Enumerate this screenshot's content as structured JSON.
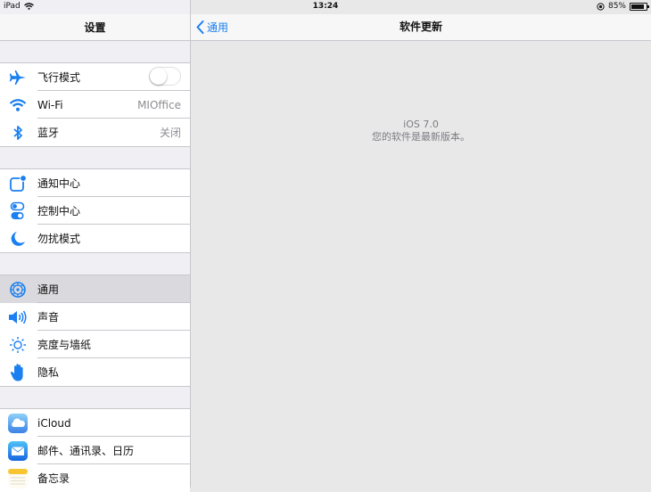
{
  "status": {
    "device": "iPad",
    "time": "13:24",
    "battery": "85%",
    "battery_level": 0.85
  },
  "master": {
    "title": "设置",
    "groups": [
      {
        "rows": [
          {
            "label": "飞行模式",
            "icon": "airplane-icon",
            "toggle": false
          },
          {
            "label": "Wi-Fi",
            "icon": "wifi-icon",
            "value": "MIOffice"
          },
          {
            "label": "蓝牙",
            "icon": "bluetooth-icon",
            "value": "关闭"
          }
        ]
      },
      {
        "rows": [
          {
            "label": "通知中心",
            "icon": "notification-center-icon"
          },
          {
            "label": "控制中心",
            "icon": "control-center-icon"
          },
          {
            "label": "勿扰模式",
            "icon": "moon-icon"
          }
        ]
      },
      {
        "rows": [
          {
            "label": "通用",
            "icon": "gear-icon",
            "selected": true
          },
          {
            "label": "声音",
            "icon": "speaker-icon"
          },
          {
            "label": "亮度与墙纸",
            "icon": "brightness-icon"
          },
          {
            "label": "隐私",
            "icon": "hand-icon"
          }
        ]
      },
      {
        "rows": [
          {
            "label": "iCloud",
            "icon": "icloud-icon"
          },
          {
            "label": "邮件、通讯录、日历",
            "icon": "mail-icon"
          },
          {
            "label": "备忘录",
            "icon": "notes-icon"
          }
        ]
      }
    ]
  },
  "detail": {
    "back_label": "通用",
    "title": "软件更新",
    "version": "iOS 7.0",
    "message": "您的软件是最新版本。"
  },
  "colors": {
    "accent": "#1a7ff0",
    "separator": "#c8c7cc",
    "background": "#efeff4"
  }
}
